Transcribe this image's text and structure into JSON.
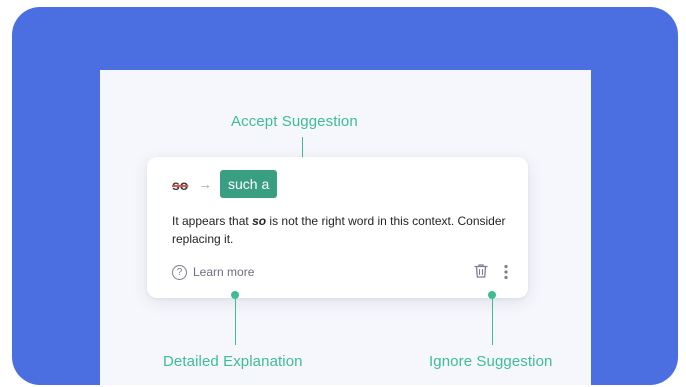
{
  "callouts": {
    "accept": "Accept Suggestion",
    "explanation": "Detailed Explanation",
    "ignore": "Ignore Suggestion"
  },
  "card": {
    "original_word": "so",
    "arrow": "→",
    "suggestion": "such a",
    "message_prefix": "It appears that ",
    "message_word": "so",
    "message_suffix": " is not the right word in this context. Consider replacing it.",
    "learn_more": "Learn more",
    "help_glyph": "?"
  },
  "icons": {
    "help": "question-circle-icon",
    "arrow": "arrow-right-icon",
    "ignore": "trash-icon",
    "more": "more-vertical-icon"
  },
  "colors": {
    "frame_blue": "#4b6fe0",
    "accent_green": "#3ebd95",
    "suggestion_green": "#3a9e82",
    "panel_bg": "#f5f7fc"
  }
}
